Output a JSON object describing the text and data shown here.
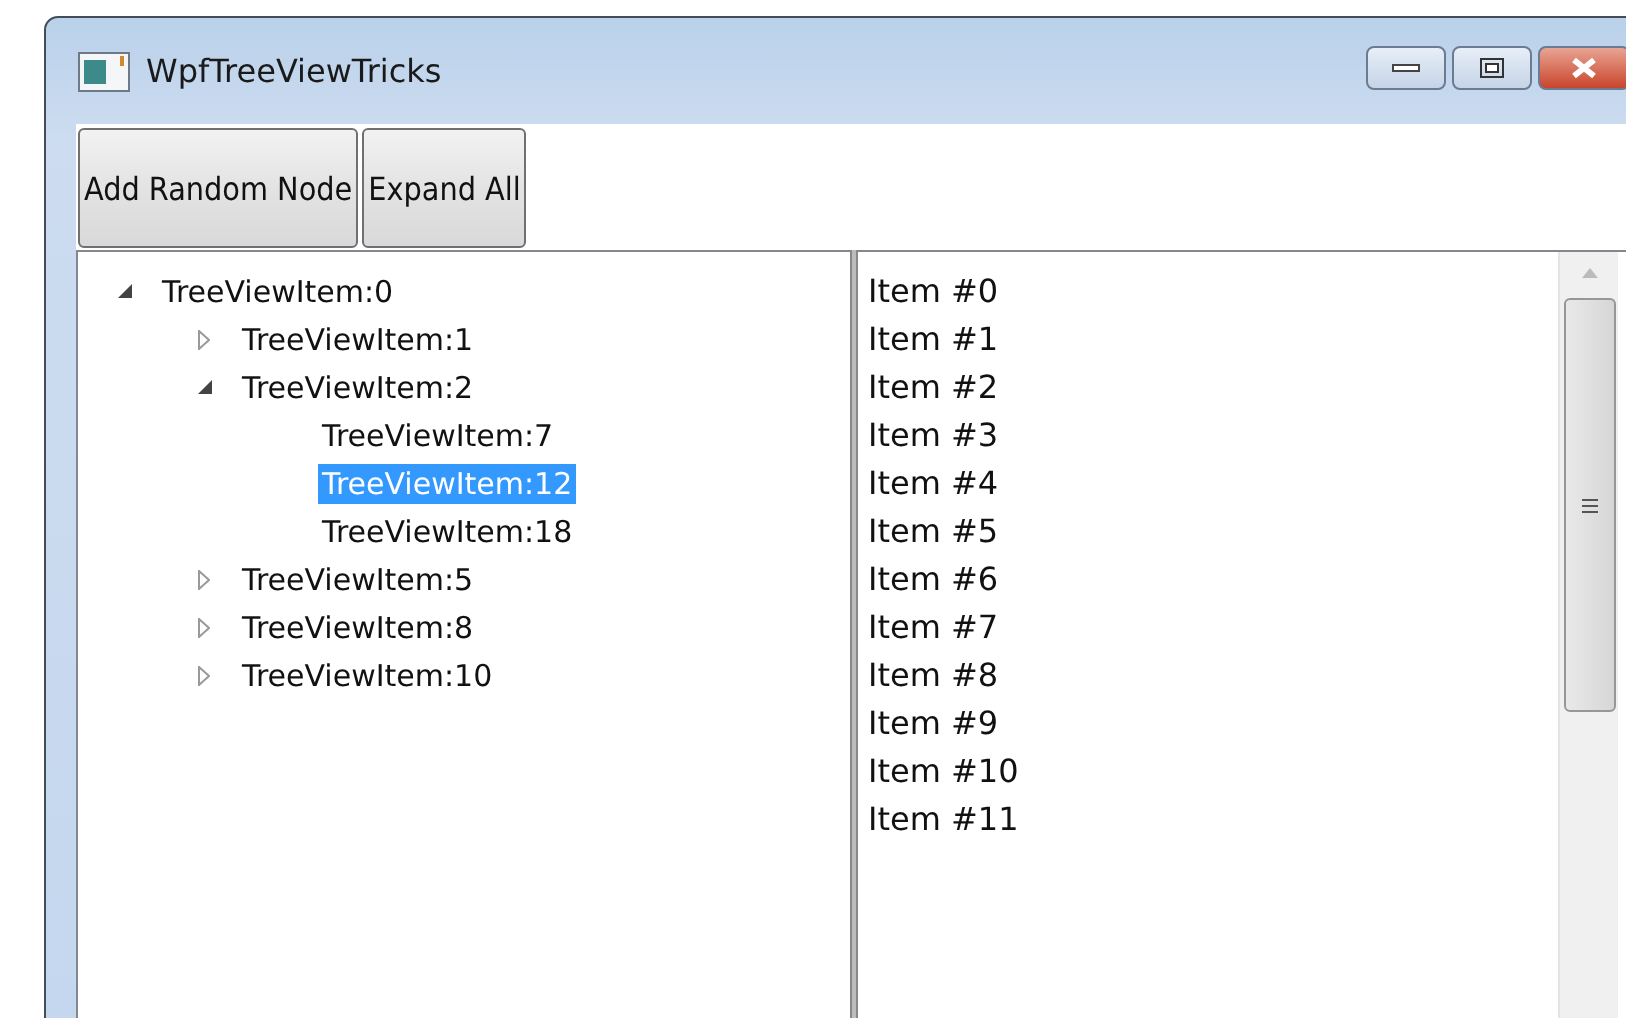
{
  "window": {
    "title": "WpfTreeViewTricks"
  },
  "toolbar": {
    "buttons": [
      "Add Random Node",
      "Expand All"
    ]
  },
  "tree": [
    {
      "label": "TreeViewItem:0",
      "expanded": true,
      "selected": false,
      "children": [
        {
          "label": "TreeViewItem:1",
          "expanded": false,
          "selected": false
        },
        {
          "label": "TreeViewItem:2",
          "expanded": true,
          "selected": false,
          "children": [
            {
              "label": "TreeViewItem:7",
              "selected": false
            },
            {
              "label": "TreeViewItem:12",
              "selected": true
            },
            {
              "label": "TreeViewItem:18",
              "selected": false
            }
          ]
        },
        {
          "label": "TreeViewItem:5",
          "expanded": false,
          "selected": false
        },
        {
          "label": "TreeViewItem:8",
          "expanded": false,
          "selected": false
        },
        {
          "label": "TreeViewItem:10",
          "expanded": false,
          "selected": false
        }
      ]
    }
  ],
  "list": {
    "items": [
      "Item #0",
      "Item #1",
      "Item #2",
      "Item #3",
      "Item #4",
      "Item #5",
      "Item #6",
      "Item #7",
      "Item #8",
      "Item #9",
      "Item #10",
      "Item #11"
    ]
  }
}
